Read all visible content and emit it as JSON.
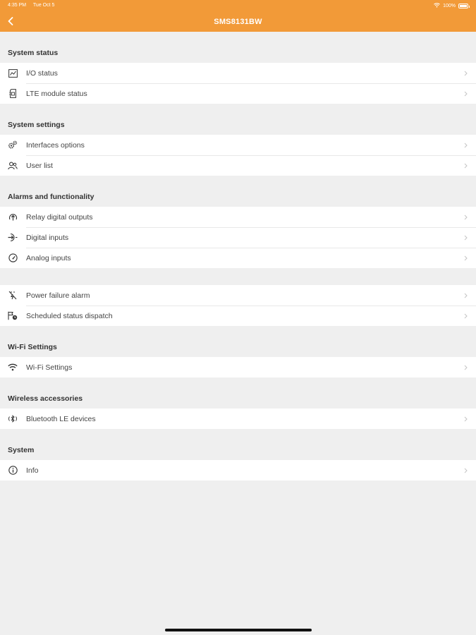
{
  "status_bar": {
    "time": "4:35 PM",
    "date": "Tue Oct 5",
    "battery": "100%"
  },
  "nav": {
    "title": "SMS8131BW"
  },
  "sections": [
    {
      "header": "System status",
      "items": [
        {
          "label": "I/O status",
          "icon": "chart-icon"
        },
        {
          "label": "LTE module status",
          "icon": "sim-icon"
        }
      ]
    },
    {
      "header": "System settings",
      "items": [
        {
          "label": "Interfaces options",
          "icon": "gears-icon"
        },
        {
          "label": "User list",
          "icon": "users-icon"
        }
      ]
    },
    {
      "header": "Alarms and functionality",
      "items": [
        {
          "label": "Relay digital outputs",
          "icon": "relay-icon"
        },
        {
          "label": "Digital inputs",
          "icon": "input-icon"
        },
        {
          "label": "Analog inputs",
          "icon": "gauge-icon"
        }
      ]
    },
    {
      "header": "",
      "items": [
        {
          "label": "Power failure alarm",
          "icon": "power-off-icon"
        },
        {
          "label": "Scheduled status dispatch",
          "icon": "schedule-icon"
        }
      ]
    },
    {
      "header": "Wi-Fi Settings",
      "items": [
        {
          "label": "Wi-Fi Settings",
          "icon": "wifi-icon"
        }
      ]
    },
    {
      "header": "Wireless accessories",
      "items": [
        {
          "label": "Bluetooth LE devices",
          "icon": "bluetooth-icon"
        }
      ]
    },
    {
      "header": "System",
      "items": [
        {
          "label": "Info",
          "icon": "info-icon"
        }
      ]
    }
  ],
  "colors": {
    "accent": "#f29a38",
    "background": "#efefef",
    "row": "#ffffff"
  }
}
